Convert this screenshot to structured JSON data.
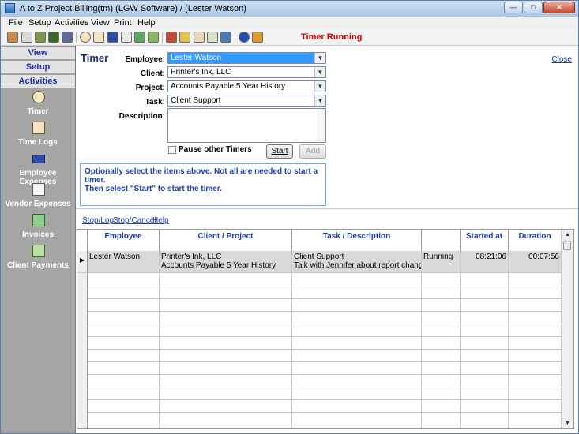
{
  "window": {
    "title": "A to Z Project Billing(tm)   (LGW Software) / (Lester Watson)"
  },
  "menubar": [
    "File",
    "Setup",
    "Activities",
    "View",
    "Print",
    "Help"
  ],
  "toolbar": {
    "status": "Timer Running"
  },
  "sidebar": {
    "tabs": [
      "View",
      "Setup",
      "Activities"
    ],
    "items": [
      {
        "label": "Timer",
        "icon": "clock-icon"
      },
      {
        "label": "Time Logs",
        "icon": "time-log-icon"
      },
      {
        "label": "Employee Expenses",
        "icon": "credit-card-icon"
      },
      {
        "label": "Vendor Expenses",
        "icon": "receipt-icon"
      },
      {
        "label": "Invoices",
        "icon": "invoice-icon"
      },
      {
        "label": "Client Payments",
        "icon": "payment-icon"
      }
    ]
  },
  "timer": {
    "heading": "Timer",
    "close": "Close",
    "labels": {
      "employee": "Employee:",
      "client": "Client:",
      "project": "Project:",
      "task": "Task:",
      "description": "Description:"
    },
    "values": {
      "employee": "Lester Watson",
      "client": "Printer's Ink, LLC",
      "project": "Accounts Payable 5 Year History",
      "task": "Client Support",
      "description": ""
    },
    "pause_label": "Pause other Timers",
    "start_label": "Start",
    "add_label": "Add",
    "info": [
      "Optionally select the items above. Not all are needed to start a timer.",
      "Then select \"Start\" to start the timer."
    ]
  },
  "links": [
    "Stop/Log",
    "Stop/Cancel",
    "Help"
  ],
  "grid": {
    "columns": [
      "Employee",
      "Client / Project",
      "Task / Description",
      "",
      "Started at",
      "Duration"
    ],
    "rows": [
      {
        "employee": "Lester Watson",
        "client": "Printer's Ink, LLC",
        "project": "Accounts Payable 5 Year History",
        "task": "Client Support",
        "description": "Talk with Jennifer about report change",
        "status": "Running",
        "started": "08:21:06",
        "duration": "00:07:56"
      }
    ]
  }
}
